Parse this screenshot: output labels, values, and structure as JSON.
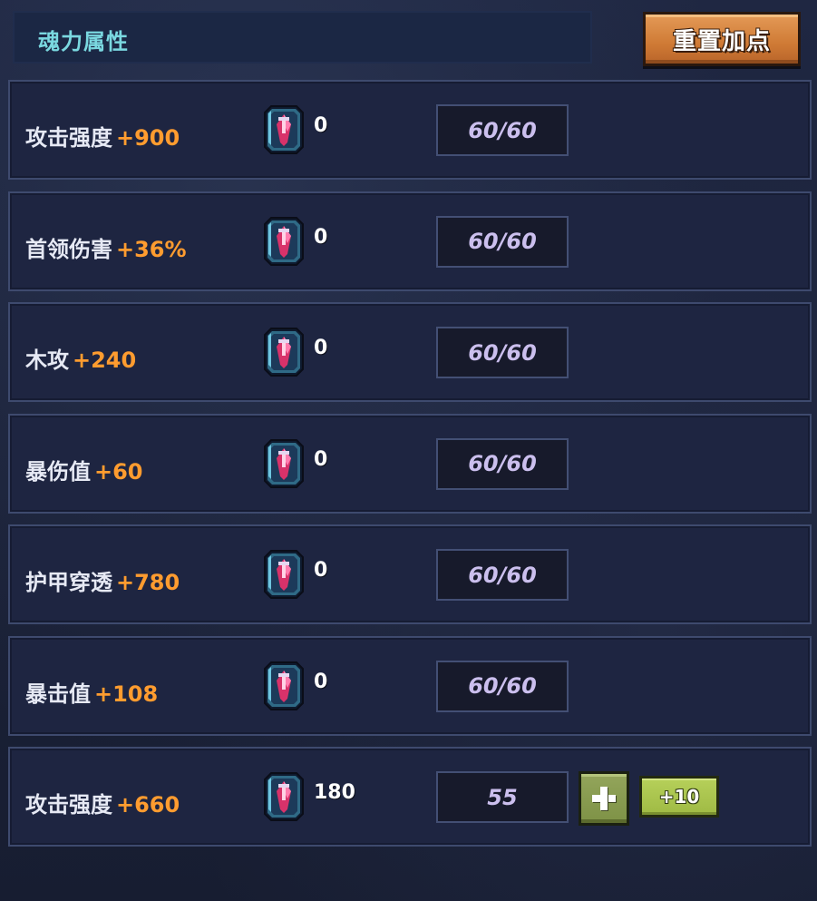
{
  "header": {
    "title": "魂力属性",
    "reset_button_label": "重置加点"
  },
  "icons": {
    "gem": "soul-gem-icon",
    "plus": "plus-icon"
  },
  "colors": {
    "title": "#7ad8e0",
    "stat_name": "#e6e9f4",
    "stat_bonus": "#ff9c2f",
    "level_text": "#cbbfee",
    "reset_button": "#d98a44",
    "plus_button": "#8a9d50",
    "plus_ten_button": "#a9c44c"
  },
  "rows": [
    {
      "name": "攻击强度",
      "bonus": "+900",
      "gem_count": "0",
      "level": "60/60"
    },
    {
      "name": "首领伤害",
      "bonus": "+36%",
      "gem_count": "0",
      "level": "60/60"
    },
    {
      "name": "木攻",
      "bonus": "+240",
      "gem_count": "0",
      "level": "60/60"
    },
    {
      "name": "暴伤值",
      "bonus": "+60",
      "gem_count": "0",
      "level": "60/60"
    },
    {
      "name": "护甲穿透",
      "bonus": "+780",
      "gem_count": "0",
      "level": "60/60"
    },
    {
      "name": "暴击值",
      "bonus": "+108",
      "gem_count": "0",
      "level": "60/60"
    },
    {
      "name": "攻击强度",
      "bonus": "+660",
      "gem_count": "180",
      "level": "55",
      "plus_ten_label": "+10"
    }
  ]
}
